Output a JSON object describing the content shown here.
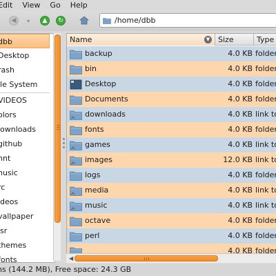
{
  "menubar": {
    "items": [
      "Edit",
      "View",
      "Go",
      "Help"
    ]
  },
  "toolbar": {
    "back_icon": "back-arrow-icon",
    "history_icon": "chevron-down-icon",
    "up_icon": "up-arrow-icon",
    "refresh_icon": "refresh-icon",
    "home_icon": "home-icon"
  },
  "location": {
    "path": "/home/dbb"
  },
  "sidebar": {
    "items": [
      {
        "label": "dbb",
        "selected": true
      },
      {
        "label": "Desktop"
      },
      {
        "label": "rash"
      },
      {
        "label": "ile System"
      },
      {
        "label": "VIDEOS"
      },
      {
        "label": "olors"
      },
      {
        "label": "lownloads"
      },
      {
        "label": "github"
      },
      {
        "label": "nnt"
      },
      {
        "label": "nusic"
      },
      {
        "label": "rc"
      },
      {
        "label": "ideos"
      },
      {
        "label": "vallpaper"
      },
      {
        "label": "ısr"
      },
      {
        "label": "themes"
      },
      {
        "label": "fonts"
      }
    ]
  },
  "columns": {
    "name": "Name",
    "size": "Size",
    "type": "Type"
  },
  "files": [
    {
      "name": "backup",
      "size": "4.0 KB",
      "type": "folder",
      "icon": "folder"
    },
    {
      "name": "bin",
      "size": "4.0 KB",
      "type": "folder",
      "icon": "folder"
    },
    {
      "name": "Desktop",
      "size": "4.0 KB",
      "type": "folder",
      "icon": "desktop"
    },
    {
      "name": "Documents",
      "size": "4.0 KB",
      "type": "folder",
      "icon": "folder"
    },
    {
      "name": "downloads",
      "size": "4.0 KB",
      "type": "link to",
      "icon": "folder-link"
    },
    {
      "name": "fonts",
      "size": "4.0 KB",
      "type": "folder",
      "icon": "folder"
    },
    {
      "name": "games",
      "size": "4.0 KB",
      "type": "link to",
      "icon": "folder-link"
    },
    {
      "name": "images",
      "size": "12.0 KB",
      "type": "link to",
      "icon": "folder-link"
    },
    {
      "name": "logs",
      "size": "4.0 KB",
      "type": "folder",
      "icon": "folder"
    },
    {
      "name": "media",
      "size": "4.0 KB",
      "type": "link to",
      "icon": "folder-link"
    },
    {
      "name": "music",
      "size": "4.0 KB",
      "type": "link to",
      "icon": "folder-link"
    },
    {
      "name": "octave",
      "size": "4.0 KB",
      "type": "folder",
      "icon": "folder"
    },
    {
      "name": "perl",
      "size": "4.0 KB",
      "type": "folder",
      "icon": "folder"
    },
    {
      "name": "",
      "size": "4.0 KB",
      "type": "folder",
      "icon": "folder"
    }
  ],
  "status": {
    "text": "ns (144.2 MB), Free space: 24.3 GB"
  },
  "colors": {
    "row_odd": "#c9d6e3",
    "row_even": "#fdd6ad",
    "accent": "#f08a2a",
    "folder": "#7fa3c6"
  }
}
